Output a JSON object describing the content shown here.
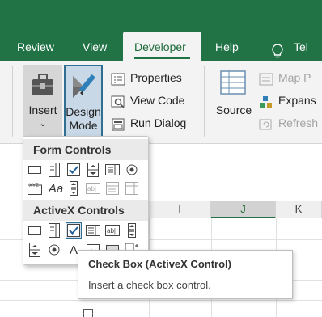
{
  "tabs": [
    {
      "label": "Review"
    },
    {
      "label": "View"
    },
    {
      "label": "Developer"
    },
    {
      "label": "Help"
    },
    {
      "label": "Tel"
    }
  ],
  "ribbon": {
    "insert": {
      "line1": "Insert",
      "line2": "⌄"
    },
    "design_mode": {
      "line1": "Design",
      "line2": "Mode"
    },
    "properties": "Properties",
    "view_code": "View Code",
    "run_dialog": "Run Dialog",
    "source": "Source",
    "map_properties": "Map P",
    "expansion_packs": "Expans",
    "refresh_data": "Refresh"
  },
  "dropdown": {
    "form_controls_header": "Form Controls",
    "activex_controls_header": "ActiveX Controls",
    "form_row2_aa": "Aa",
    "activex_row2_a": "A"
  },
  "columns": [
    "I",
    "J",
    "K"
  ],
  "tooltip": {
    "title": "Check Box (ActiveX Control)",
    "description": "Insert a check box control."
  },
  "colors": {
    "brand_green": "#217346",
    "highlight_blue": "#2f6f92"
  }
}
